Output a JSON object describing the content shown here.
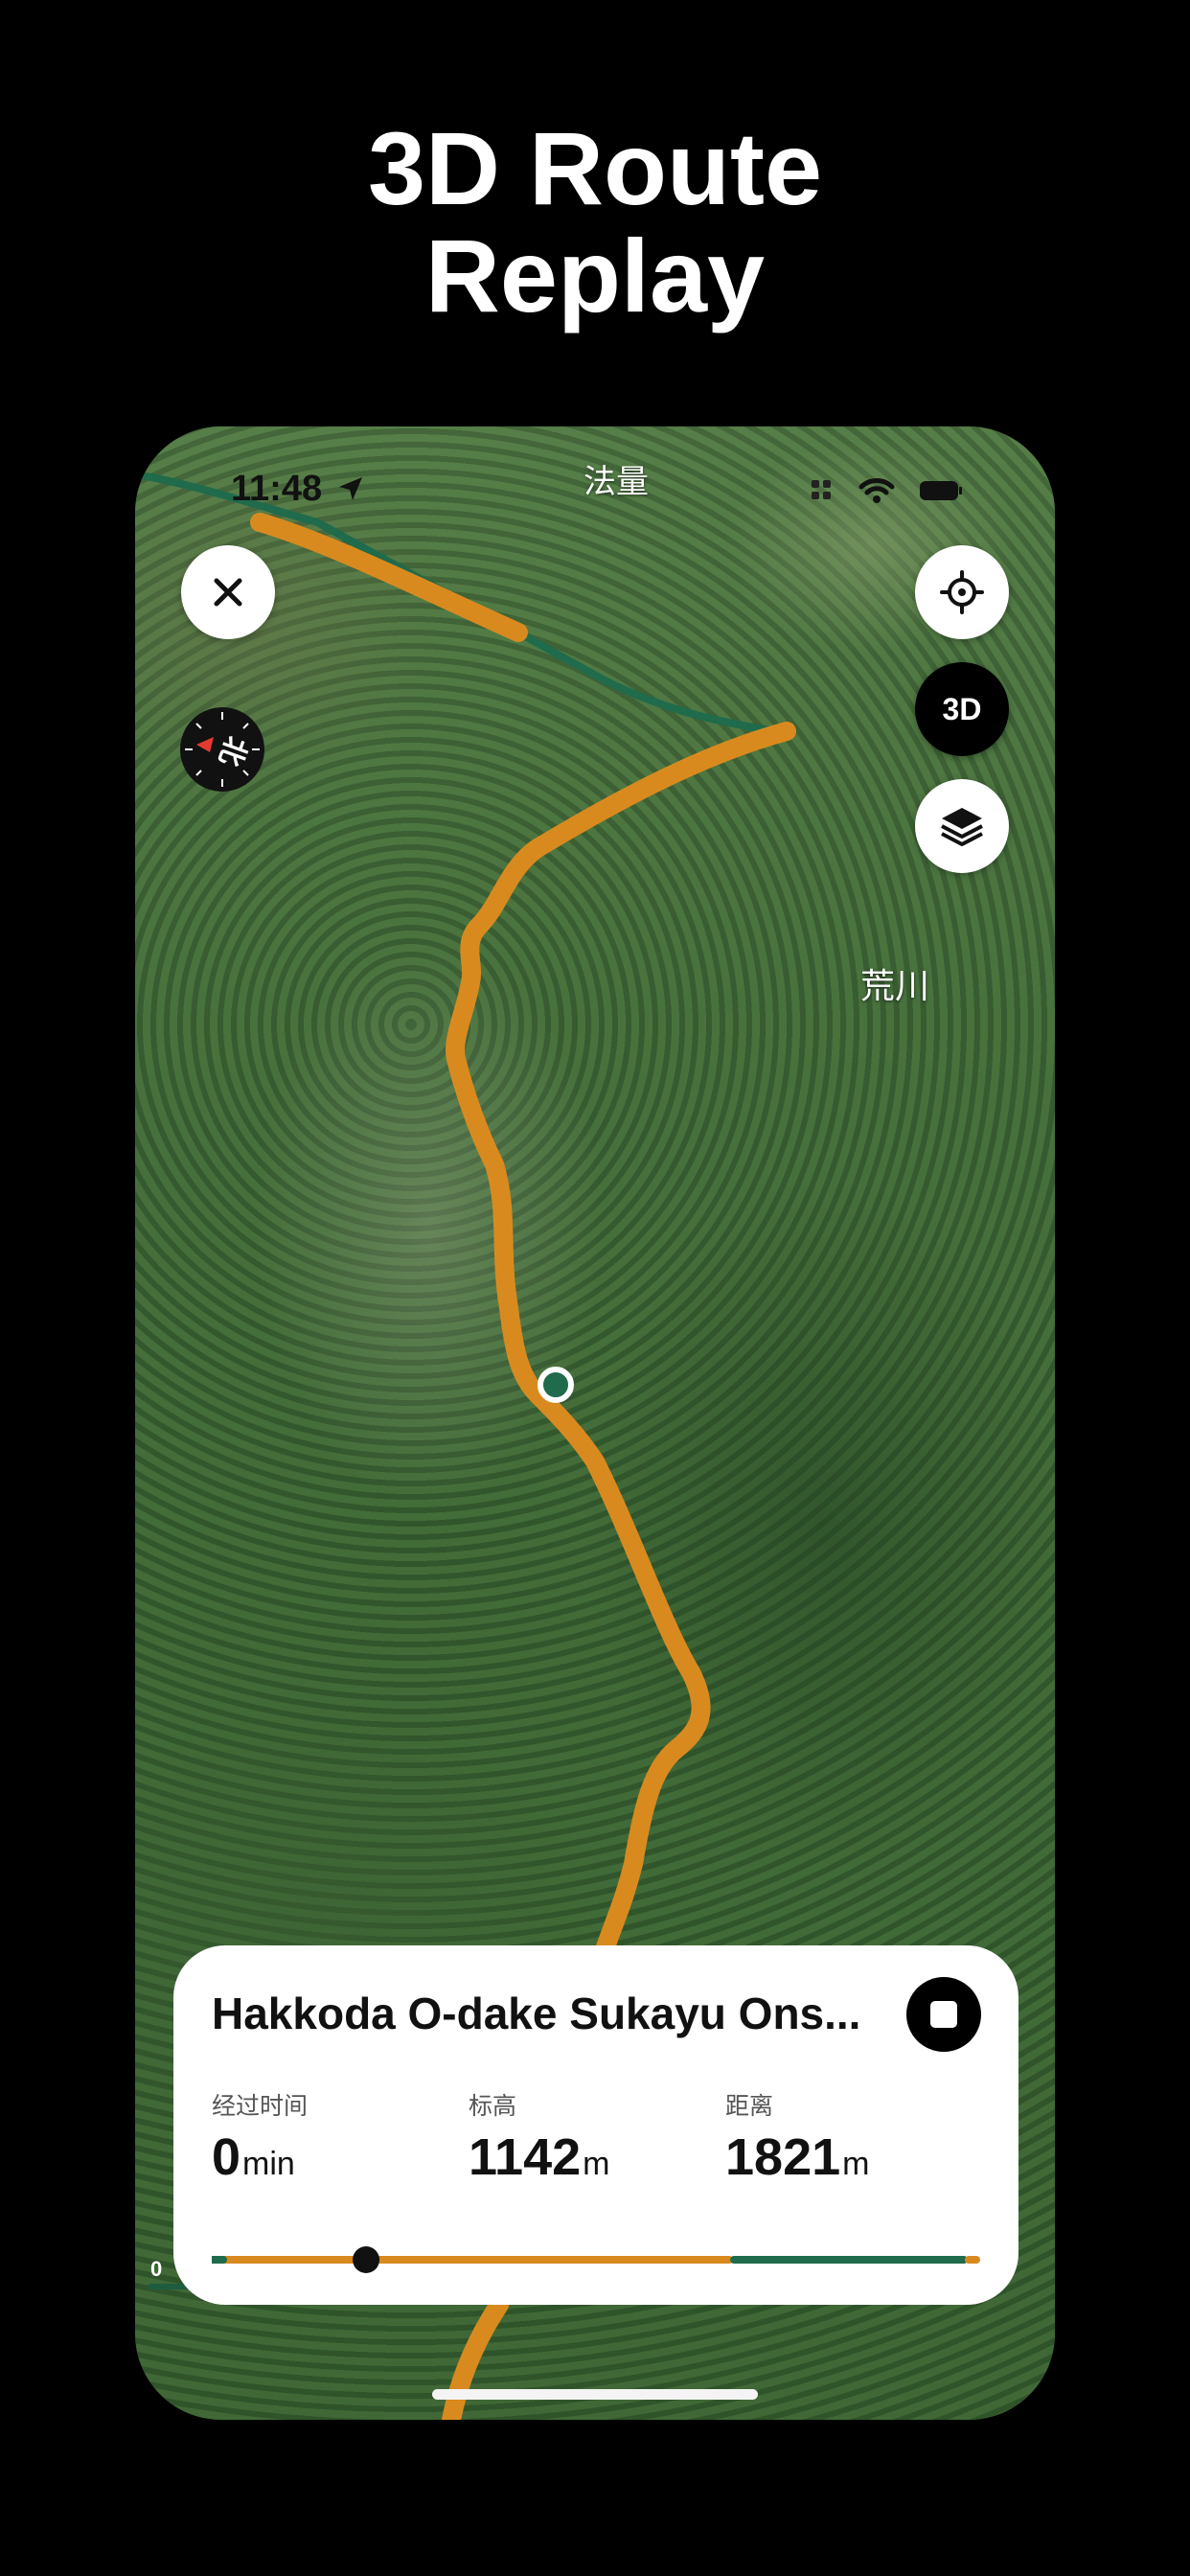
{
  "headline": {
    "line1": "3D Route",
    "line2": "Replay"
  },
  "status_bar": {
    "time": "11:48",
    "location_label": "法量"
  },
  "map": {
    "place_label": "荒川",
    "compass_label": "北",
    "scale_zero": "0",
    "route_color": "#d98a1f",
    "replayed_color": "#1f6b4c"
  },
  "controls": {
    "close_icon": "close-icon",
    "locate_icon": "locate-icon",
    "mode_3d_label": "3D",
    "layers_icon": "layers-icon"
  },
  "card": {
    "title": "Hakkoda O-dake Sukayu Ons...",
    "stats": [
      {
        "label": "经过时间",
        "value": "0",
        "unit": "min"
      },
      {
        "label": "标高",
        "value": "1142",
        "unit": "m"
      },
      {
        "label": "距离",
        "value": "1821",
        "unit": "m"
      }
    ],
    "progress_fraction": 0.19
  }
}
